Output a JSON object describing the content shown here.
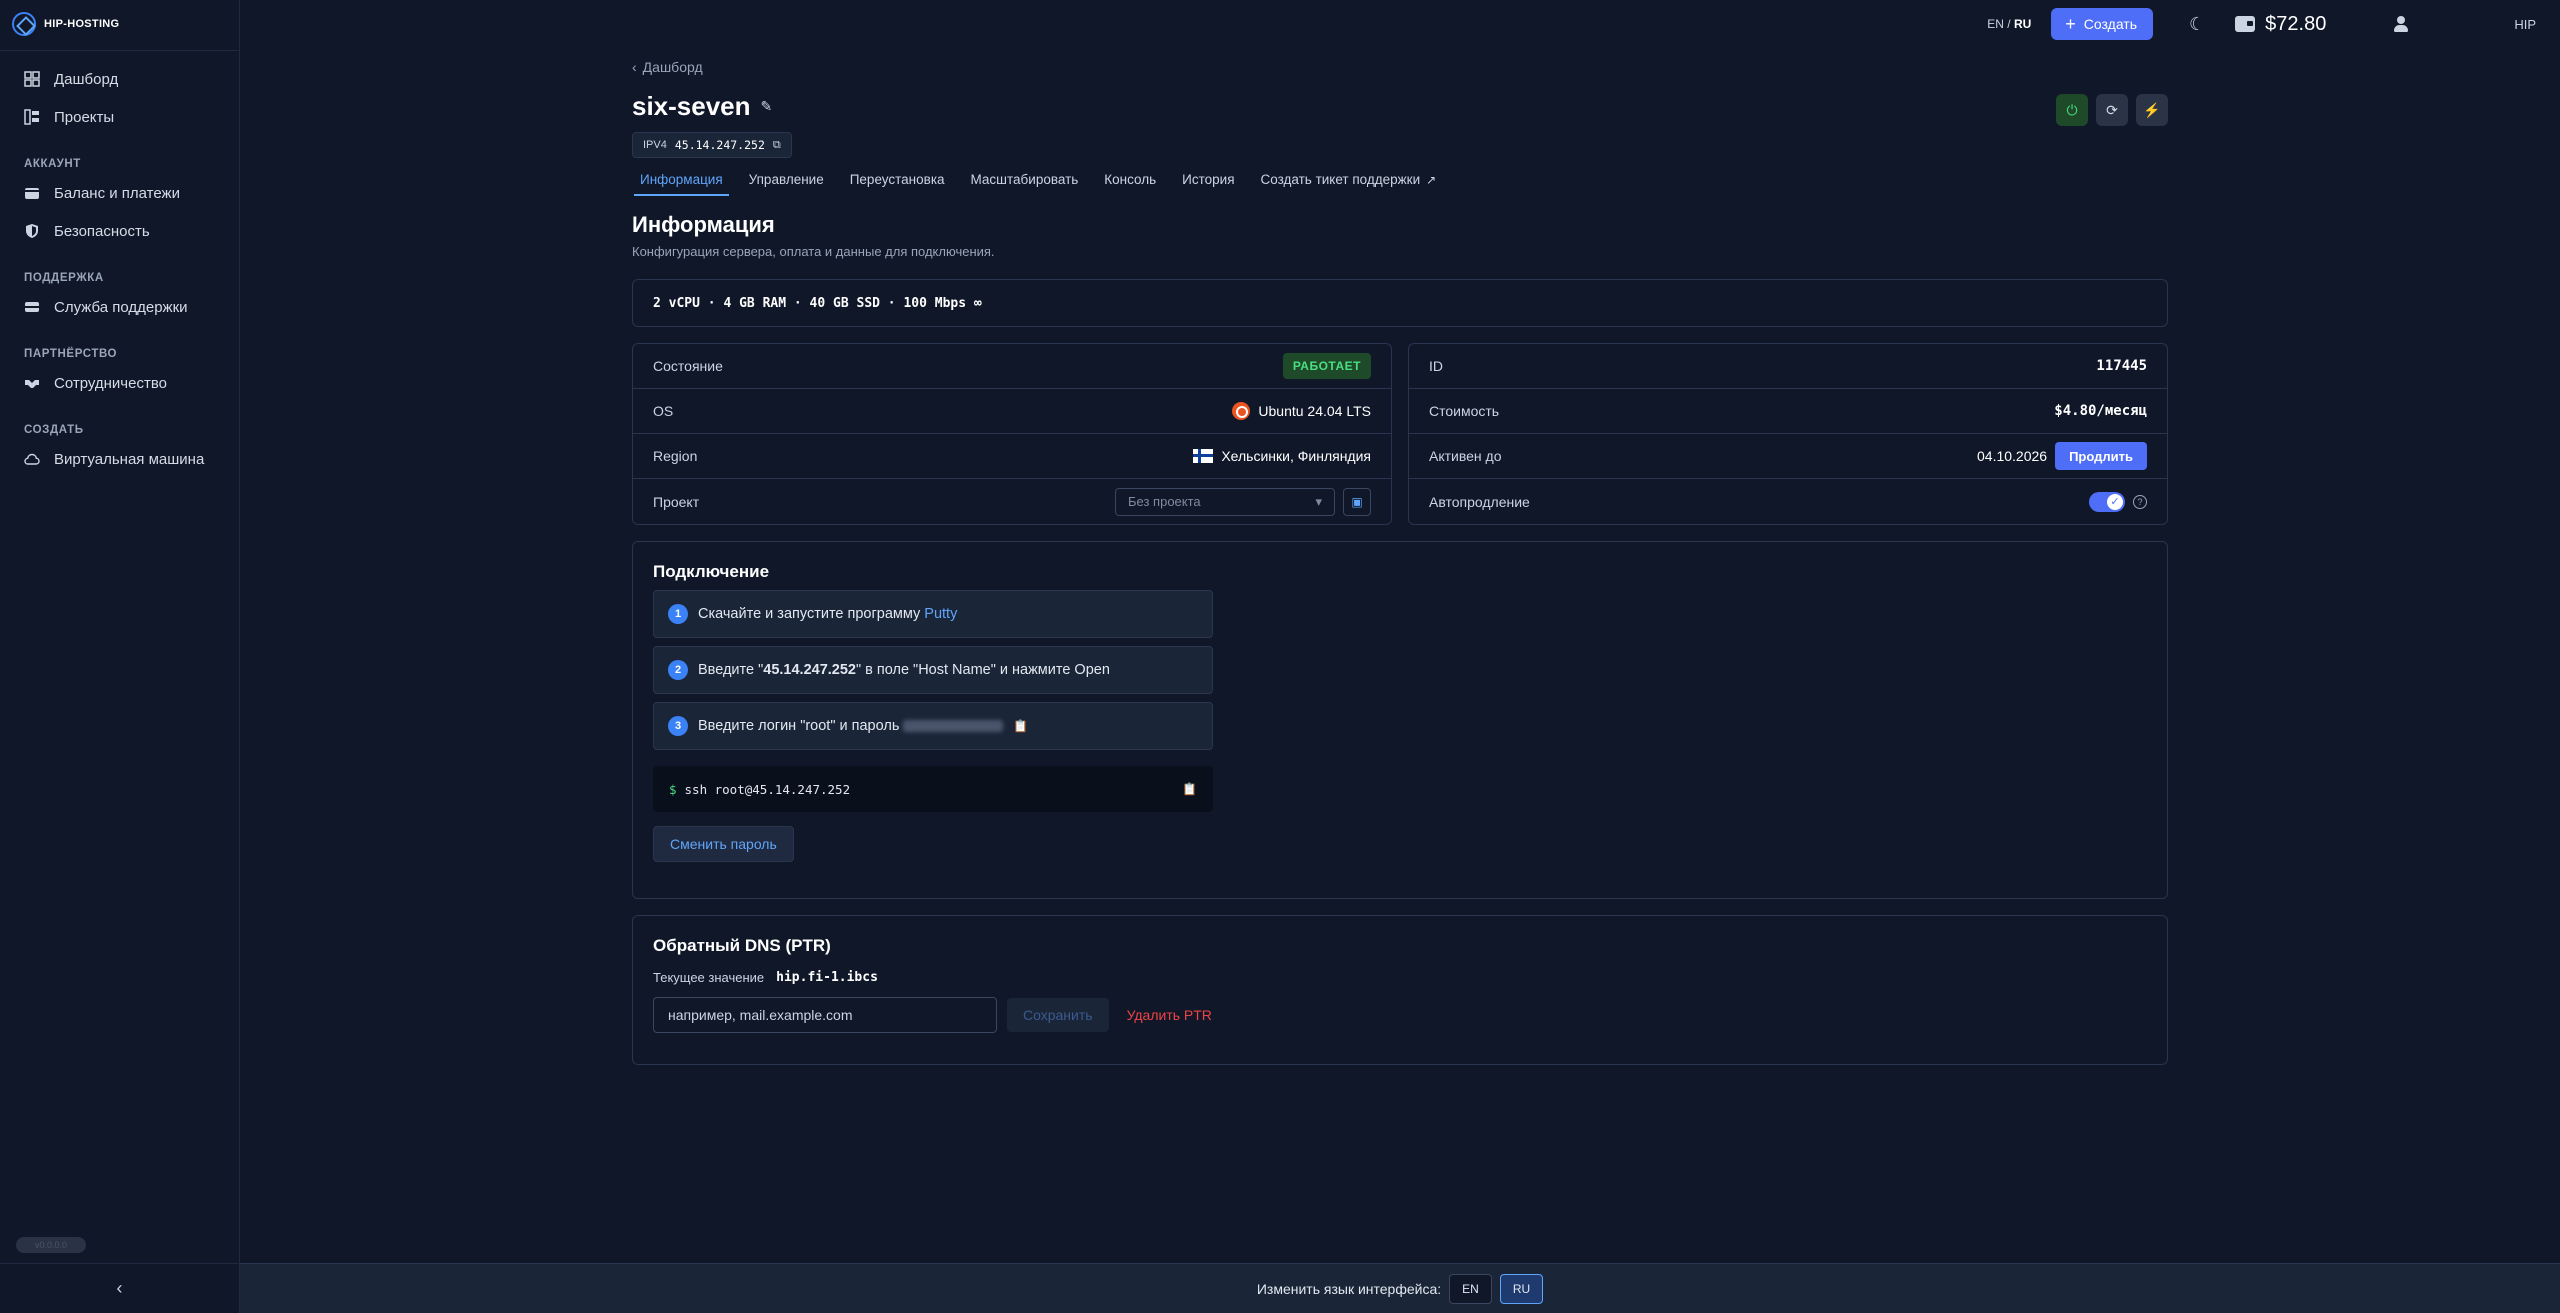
{
  "brand": {
    "name": "HIP-HOSTING"
  },
  "sidebar": {
    "items": [
      {
        "label": "Дашборд",
        "icon": "grid-icon"
      },
      {
        "label": "Проекты",
        "icon": "projects-icon"
      }
    ],
    "sections": [
      {
        "title": "АККАУНТ",
        "items": [
          {
            "label": "Баланс и платежи",
            "icon": "wallet-icon"
          },
          {
            "label": "Безопасность",
            "icon": "shield-icon"
          }
        ]
      },
      {
        "title": "ПОДДЕРЖКА",
        "items": [
          {
            "label": "Служба поддержки",
            "icon": "ticket-icon"
          }
        ]
      },
      {
        "title": "ПАРТНЁРСТВО",
        "items": [
          {
            "label": "Сотрудничество",
            "icon": "handshake-icon"
          }
        ]
      },
      {
        "title": "СОЗДАТЬ",
        "items": [
          {
            "label": "Виртуальная машина",
            "icon": "cloud-icon"
          }
        ]
      }
    ],
    "version_badge": "v0.0.0.0",
    "collapse_icon": "chevron-left-icon"
  },
  "header": {
    "lang_en": "EN",
    "lang_sep": "/",
    "lang_ru": "RU",
    "create_label": "Создать",
    "balance": "$72.80",
    "username": "HIP"
  },
  "main": {
    "breadcrumb": "Дашборд",
    "server_name": "six-seven",
    "ipv4_label": "IPV4",
    "ipv4": "45.14.247.252",
    "tabs": [
      {
        "label": "Информация",
        "active": true
      },
      {
        "label": "Управление"
      },
      {
        "label": "Переустановка"
      },
      {
        "label": "Масштабировать"
      },
      {
        "label": "Консоль"
      },
      {
        "label": "История"
      },
      {
        "label": "Создать тикет поддержки"
      }
    ],
    "section_title": "Информация",
    "section_subtitle": "Конфигурация сервера, оплата и данные для подключения.",
    "specs": "2 vCPU · 4 GB RAM · 40 GB SSD · 100 Mbps",
    "left_card": {
      "state_label": "Состояние",
      "state_value": "РАБОТАЕТ",
      "os_label": "OS",
      "os_value": "Ubuntu 24.04 LTS",
      "region_label": "Region",
      "region_value": "Хельсинки, Финляндия",
      "project_label": "Проект",
      "project_placeholder": "Без проекта"
    },
    "right_card": {
      "id_label": "ID",
      "id_value": "117445",
      "cost_label": "Стоимость",
      "cost_value": "$4.80/месяц",
      "active_label": "Активен до",
      "active_value": "04.10.2026",
      "renew_label": "Продлить",
      "autorenew_label": "Автопродление",
      "autorenew_on": true
    },
    "connection": {
      "title": "Подключение",
      "step1_text": "Скачайте и запустите программу ",
      "step1_link": "Putty",
      "step2_pre": "Введите \"",
      "step2_ip": "45.14.247.252",
      "step2_post": "\" в поле \"Host Name\" и нажмите Open",
      "step3_text": "Введите логин \"root\" и пароль ",
      "command": "ssh root@45.14.247.252",
      "change_password": "Сменить пароль"
    },
    "ptr": {
      "title": "Обратный DNS (PTR)",
      "current_label": "Текущее значение",
      "current_value": "hip.fi-1.ibcs",
      "placeholder": "например, mail.example.com",
      "save_label": "Сохранить",
      "delete_label": "Удалить PTR"
    }
  },
  "footer": {
    "label": "Изменить язык интерфейса:",
    "en": "EN",
    "ru": "RU",
    "active": "RU"
  },
  "colors": {
    "accent": "#4f6ef7",
    "success": "#4ade80",
    "danger": "#ef4444",
    "bg": "#0f1729"
  }
}
